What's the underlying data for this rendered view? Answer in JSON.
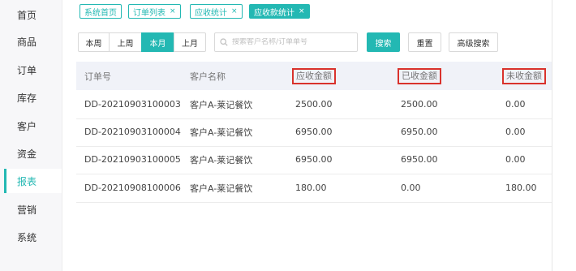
{
  "sidebar": {
    "items": [
      {
        "label": "首页"
      },
      {
        "label": "商品"
      },
      {
        "label": "订单"
      },
      {
        "label": "库存"
      },
      {
        "label": "客户"
      },
      {
        "label": "资金"
      },
      {
        "label": "报表"
      },
      {
        "label": "营销"
      },
      {
        "label": "系统"
      }
    ],
    "active": "报表"
  },
  "tabs": [
    {
      "label": "系统首页",
      "closable": false
    },
    {
      "label": "订单列表",
      "closable": true
    },
    {
      "label": "应收统计",
      "closable": true
    },
    {
      "label": "应收款统计",
      "closable": true,
      "active": true
    }
  ],
  "tab_close_glyph": "×",
  "period_filter": {
    "options": [
      "本周",
      "上周",
      "本月",
      "上月"
    ],
    "selected": "本月"
  },
  "search": {
    "placeholder": "搜索客户名称/订单单号",
    "value": "",
    "icon": "search-icon"
  },
  "toolbar": {
    "search_label": "搜索",
    "reset_label": "重置",
    "advanced_label": "高级搜索"
  },
  "table": {
    "columns": [
      "订单号",
      "客户名称",
      "应收金额",
      "已收金额",
      "未收金额"
    ],
    "highlighted_columns": [
      "应收金额",
      "已收金额",
      "未收金额"
    ],
    "rows": [
      [
        "DD-20210903100003",
        "客户A-莱记餐饮",
        "2500.00",
        "2500.00",
        "0.00"
      ],
      [
        "DD-20210903100004",
        "客户A-莱记餐饮",
        "6950.00",
        "6950.00",
        "0.00"
      ],
      [
        "DD-20210903100005",
        "客户A-莱记餐饮",
        "6950.00",
        "6950.00",
        "0.00"
      ],
      [
        "DD-20210908100006",
        "客户A-莱记餐饮",
        "180.00",
        "0.00",
        "180.00"
      ]
    ]
  },
  "colors": {
    "accent": "#23b8b3",
    "highlight_border": "#d9322c",
    "header_bg": "#f0f2f8"
  }
}
